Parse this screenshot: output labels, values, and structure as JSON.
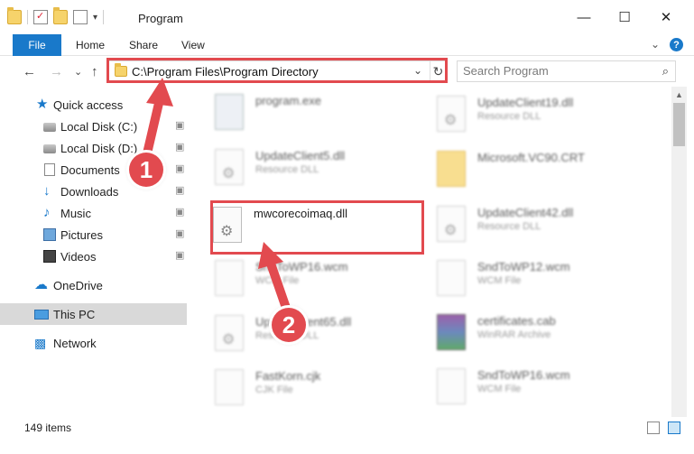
{
  "window": {
    "title": "Program",
    "controls": {
      "minimize": "—",
      "maximize": "☐",
      "close": "✕"
    }
  },
  "quick_access_toolbar": {
    "icons": [
      "folder-icon",
      "properties-icon",
      "new-folder-icon",
      "customize-icon"
    ],
    "dropdown": "▾"
  },
  "ribbon": {
    "tabs": [
      "File",
      "Home",
      "Share",
      "View"
    ],
    "expand": "⌄",
    "help": "?"
  },
  "navigation": {
    "back": "←",
    "forward": "→",
    "recent": "⌄",
    "up": "↑",
    "address_path": "C:\\Program Files\\Program Directory",
    "address_dropdown": "⌄",
    "refresh": "↻",
    "search_placeholder": "Search Program",
    "search_icon": "⌕"
  },
  "sidebar": {
    "items": [
      {
        "label": "Quick access",
        "icon": "quick-access-star-icon",
        "pinned": false
      },
      {
        "label": "Local Disk (C:)",
        "icon": "disk-icon",
        "pinned": true
      },
      {
        "label": "Local Disk (D:)",
        "icon": "disk-icon",
        "pinned": true
      },
      {
        "label": "Documents",
        "icon": "documents-icon",
        "pinned": true
      },
      {
        "label": "Downloads",
        "icon": "downloads-icon",
        "pinned": true
      },
      {
        "label": "Music",
        "icon": "music-icon",
        "pinned": true
      },
      {
        "label": "Pictures",
        "icon": "pictures-icon",
        "pinned": true
      },
      {
        "label": "Videos",
        "icon": "videos-icon",
        "pinned": true
      },
      {
        "label": "OneDrive",
        "icon": "onedrive-icon",
        "pinned": false
      },
      {
        "label": "This PC",
        "icon": "this-pc-icon",
        "pinned": false,
        "selected": true
      },
      {
        "label": "Network",
        "icon": "network-icon",
        "pinned": false
      }
    ],
    "pin_glyph": "📌"
  },
  "files": {
    "left_column": [
      {
        "name": "program.exe",
        "type": "",
        "icon": "exe-icon"
      },
      {
        "name": "UpdateClient5.dll",
        "type": "Resource DLL",
        "icon": "dll-icon"
      },
      {
        "name": "mwcorecoimaq.dll",
        "type": "",
        "icon": "dll-icon",
        "highlighted": true
      },
      {
        "name": "SndToWP16.wcm",
        "type": "WCM File",
        "icon": "generic-file-icon"
      },
      {
        "name": "UpdateClient65.dll",
        "type": "Resource DLL",
        "icon": "dll-icon"
      },
      {
        "name": "FastKorn.cjk",
        "type": "CJK File",
        "icon": "generic-file-icon"
      }
    ],
    "right_column": [
      {
        "name": "UpdateClient19.dll",
        "type": "Resource DLL",
        "icon": "dll-icon"
      },
      {
        "name": "Microsoft.VC90.CRT",
        "type": "",
        "icon": "folder-icon"
      },
      {
        "name": "UpdateClient42.dll",
        "type": "Resource DLL",
        "icon": "dll-icon"
      },
      {
        "name": "SndToWP12.wcm",
        "type": "WCM File",
        "icon": "generic-file-icon"
      },
      {
        "name": "certificates.cab",
        "type": "WinRAR Archive",
        "icon": "winrar-archive-icon"
      },
      {
        "name": "SndToWP16.wcm",
        "type": "WCM File",
        "icon": "generic-file-icon"
      }
    ]
  },
  "status": {
    "item_count": "149 items",
    "view_icons": [
      "details-view-icon",
      "large-icons-view-icon"
    ]
  },
  "annotations": {
    "step1": "1",
    "step2": "2",
    "color": "#e24a4f"
  }
}
